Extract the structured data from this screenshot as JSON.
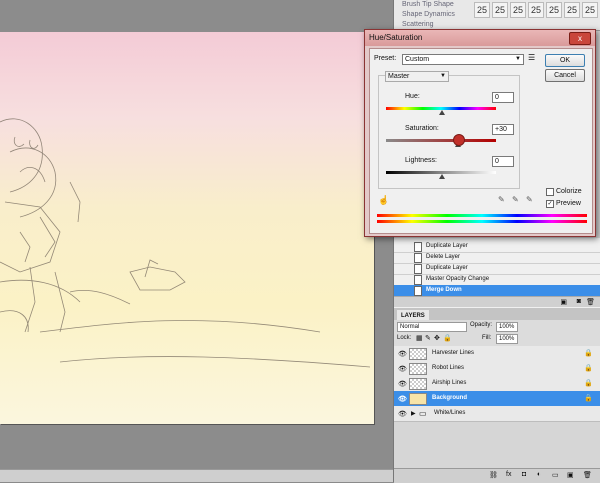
{
  "brushes": {
    "items": [
      "Brush Tip Shape",
      "Shape Dynamics",
      "Scattering"
    ],
    "sizes": [
      "25",
      "25",
      "25",
      "25",
      "25",
      "25",
      "25"
    ]
  },
  "dialog": {
    "title": "Hue/Saturation",
    "close": "x",
    "preset_label": "Preset:",
    "preset_value": "Custom",
    "ok": "OK",
    "cancel": "Cancel",
    "channel": "Master",
    "hue_label": "Hue:",
    "hue_value": "0",
    "saturation_label": "Saturation:",
    "saturation_value": "+30",
    "saturation_level": 0.65,
    "lightness_label": "Lightness:",
    "lightness_value": "0",
    "colorize_label": "Colorize",
    "preview_label": "Preview",
    "preview_checked": "✓"
  },
  "history": {
    "items": [
      {
        "label": "Duplicate Layer",
        "selected": false
      },
      {
        "label": "Delete Layer",
        "selected": false
      },
      {
        "label": "Duplicate Layer",
        "selected": false
      },
      {
        "label": "Master Opacity Change",
        "selected": false
      },
      {
        "label": "Merge Down",
        "selected": true
      }
    ]
  },
  "layers": {
    "tab": "LAYERS",
    "blend_mode": "Normal",
    "opacity_label": "Opacity:",
    "opacity_value": "100%",
    "lock_label": "Lock:",
    "fill_label": "Fill:",
    "fill_value": "100%",
    "items": [
      {
        "name": "Harvester Lines",
        "locked": true
      },
      {
        "name": "Robot Lines",
        "locked": true
      },
      {
        "name": "Airship Lines",
        "locked": true
      },
      {
        "name": "Background",
        "locked": true,
        "selected": true
      },
      {
        "name": "White/Lines",
        "group": true
      }
    ]
  }
}
